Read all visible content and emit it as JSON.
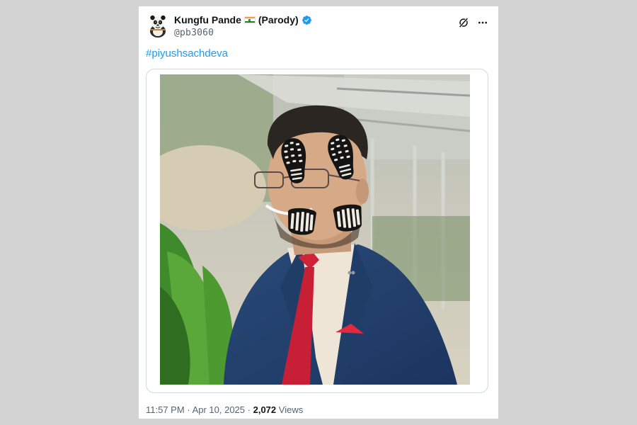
{
  "post": {
    "author": {
      "display_name": "Kungfu Pande",
      "parody_label": "(Parody)",
      "handle": "@pb3060",
      "verified": true,
      "avatar_icon": "kungfu-panda-avatar-icon"
    },
    "flag": {
      "icon": "india-flag-icon",
      "colors": {
        "saffron": "#ff9933",
        "white": "#ffffff",
        "green": "#138808"
      }
    },
    "actions": {
      "grok_icon": "grok-icon",
      "more_icon": "more-dots-icon"
    },
    "text": {
      "hashtag": "#piyushsachdeva"
    },
    "media": {
      "type": "photo",
      "subject_icon": "shoe-print-overlay"
    },
    "meta": {
      "time": "11:57 PM",
      "separator": "·",
      "date": "Apr 10, 2025",
      "views_count": "2,072",
      "views_label": "Views"
    }
  },
  "colors": {
    "link": "#1d9bf0",
    "verified": "#1d9bf0",
    "muted_text": "#536471",
    "primary_text": "#0f1419",
    "border": "#cfd9de",
    "page_background": "#d3d3d3"
  }
}
